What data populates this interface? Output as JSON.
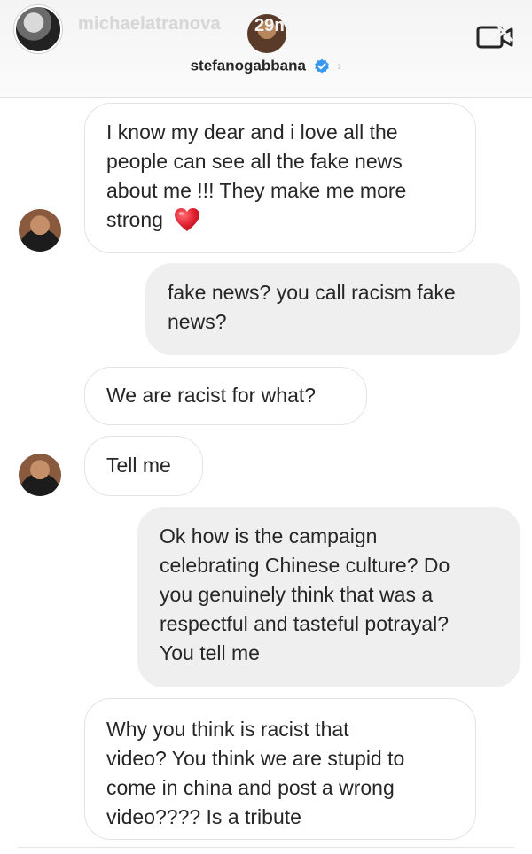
{
  "story": {
    "username": "michaelatranova",
    "time": "29m"
  },
  "thread": {
    "title": "stefanogabbana",
    "verified_icon": "verified-badge-icon",
    "chevron_icon": "chevron-right-icon"
  },
  "messages": [
    {
      "sender": "them",
      "lines": [
        "I know my dear and i love all the",
        "people can see all the fake news",
        "about me !!! They make me more",
        "strong"
      ],
      "emoji": "heart-icon"
    },
    {
      "sender": "me",
      "lines": [
        "fake news? you call racism fake",
        "news?"
      ]
    },
    {
      "sender": "them",
      "lines": [
        "We are racist for what?"
      ]
    },
    {
      "sender": "them",
      "lines": [
        "Tell me"
      ]
    },
    {
      "sender": "me",
      "lines": [
        "Ok how is the campaign",
        "celebrating Chinese culture? Do",
        "you genuinely think that was a",
        "respectful and tasteful potrayal?",
        "You tell me"
      ]
    },
    {
      "sender": "them",
      "lines": [
        "Why you think is racist that",
        "video? You think we are stupid to",
        "come in china and post a wrong",
        "video???? Is a tribute"
      ]
    }
  ],
  "colors": {
    "incoming_bubble": "#ffffff",
    "outgoing_bubble": "#efefef",
    "verified_blue": "#3897f0",
    "heart_red": "#e0202f"
  }
}
